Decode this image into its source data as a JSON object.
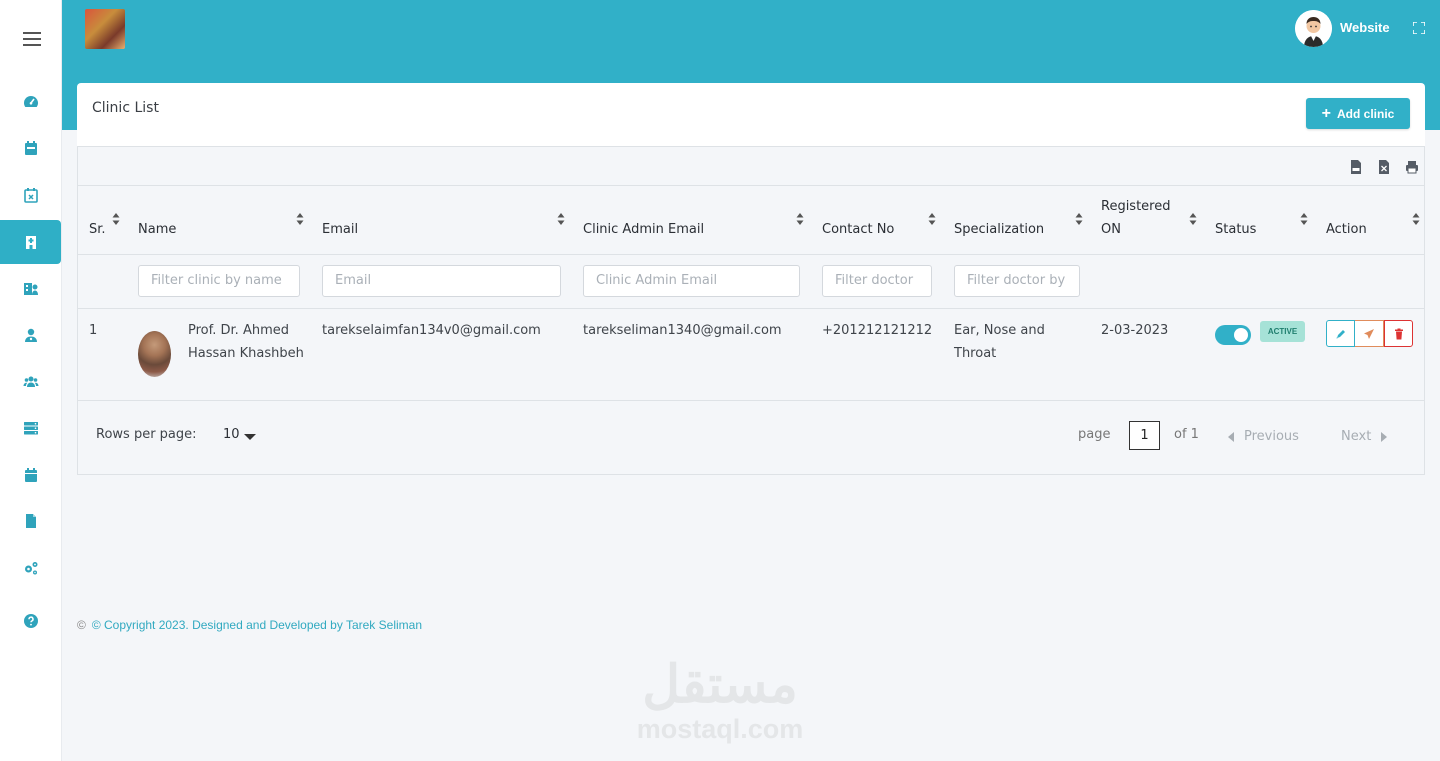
{
  "sidebar": {
    "items": [
      {
        "icon": "dashboard-icon"
      },
      {
        "icon": "calendar-icon"
      },
      {
        "icon": "calendar-x-icon"
      },
      {
        "icon": "clinic-icon",
        "active": true
      },
      {
        "icon": "doctor-group-icon"
      },
      {
        "icon": "user-doctor-icon"
      },
      {
        "icon": "users-icon"
      },
      {
        "icon": "server-icon"
      },
      {
        "icon": "calendar-alt-icon"
      },
      {
        "icon": "file-icon"
      },
      {
        "icon": "cogs-icon"
      },
      {
        "icon": "help-icon"
      }
    ]
  },
  "topbar": {
    "website_label": "Website"
  },
  "card": {
    "title": "Clinic List",
    "add_button": "Add clinic"
  },
  "table": {
    "headers": {
      "sr": "Sr.",
      "name": "Name",
      "email": "Email",
      "admin_email": "Clinic Admin Email",
      "contact": "Contact No",
      "specialization": "Specialization",
      "registered": "Registered ON",
      "status": "Status",
      "action": "Action"
    },
    "filters": {
      "name": "Filter clinic by name",
      "email": "Email",
      "admin_email": "Clinic Admin Email",
      "contact": "Filter doctor",
      "specialization": "Filter doctor by"
    },
    "rows": [
      {
        "sr": "1",
        "name": "Prof. Dr. Ahmed Hassan Khashbeh",
        "email": "tarekselaimfan134v0@gmail.com",
        "admin_email": "tarekseliman1340@gmail.com",
        "contact": "+201212121212",
        "specialization": "Ear, Nose and Throat",
        "registered": "2-03-2023",
        "status_on": true,
        "badge": "ACTIVE"
      }
    ]
  },
  "pagination": {
    "rows_label": "Rows per page:",
    "rows_value": "10",
    "page_label": "page",
    "page_value": "1",
    "of_label": "of 1",
    "previous": "Previous",
    "next": "Next"
  },
  "footer": {
    "copyright_symbol": "©",
    "copyright": "© Copyright 2023. Designed and Developed by Tarek Seliman"
  },
  "watermark": {
    "arabic": "مستقل",
    "latin": "mostaql.com"
  },
  "colors": {
    "accent": "#31b0c8",
    "badge_bg": "#a6e2d7",
    "danger": "#dd3333",
    "send": "#e08c5c"
  }
}
